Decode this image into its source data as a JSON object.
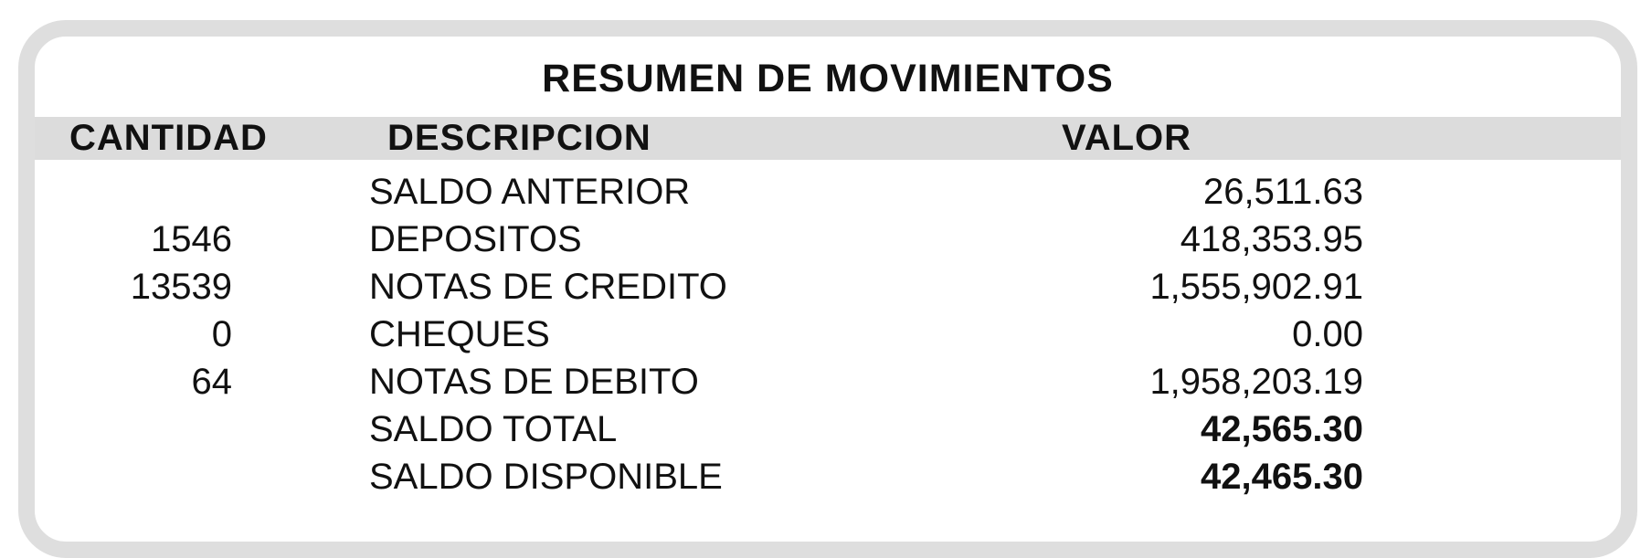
{
  "title": "RESUMEN DE MOVIMIENTOS",
  "headers": {
    "cantidad": "CANTIDAD",
    "descripcion": "DESCRIPCION",
    "valor": "VALOR"
  },
  "rows": [
    {
      "cantidad": "",
      "descripcion": "SALDO ANTERIOR",
      "valor": "26,511.63"
    },
    {
      "cantidad": "1546",
      "descripcion": "DEPOSITOS",
      "valor": "418,353.95"
    },
    {
      "cantidad": "13539",
      "descripcion": "NOTAS DE CREDITO",
      "valor": "1,555,902.91"
    },
    {
      "cantidad": "0",
      "descripcion": "CHEQUES",
      "valor": "0.00"
    },
    {
      "cantidad": "64",
      "descripcion": "NOTAS DE DEBITO",
      "valor": "1,958,203.19"
    },
    {
      "cantidad": "",
      "descripcion": "SALDO TOTAL",
      "valor": "42,565.30"
    },
    {
      "cantidad": "",
      "descripcion": "SALDO DISPONIBLE",
      "valor": "42,465.30"
    }
  ],
  "colors": {
    "border": "#dedede",
    "header_band": "#dcdcdc",
    "text": "#111111"
  }
}
